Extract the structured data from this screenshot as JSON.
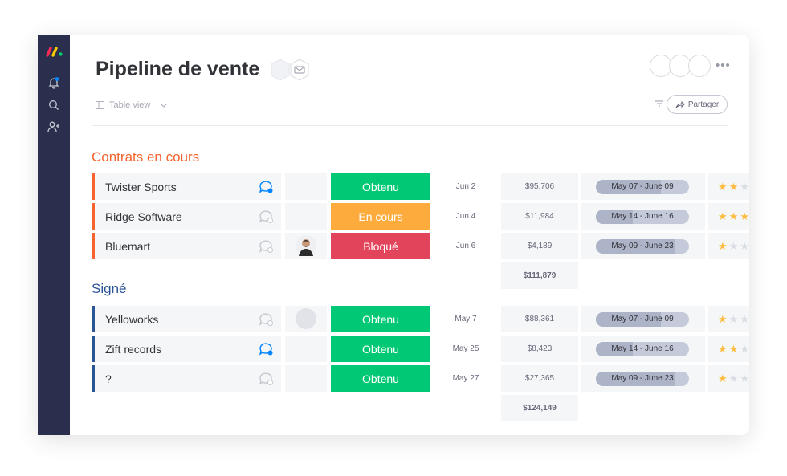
{
  "app": {
    "board_title": "Pipeline de vente",
    "view_label": "Table view",
    "share_label": "Partager",
    "more_label": "•••",
    "brand_colors": [
      "#f62b54",
      "#ffcb00",
      "#00ca72"
    ],
    "rail_icons": [
      "bell-icon",
      "search-icon",
      "add-user-icon"
    ]
  },
  "colors": {
    "group_orange": "#f5642d",
    "group_blue": "#2a5495",
    "status_done": "#00c875",
    "status_working": "#fdab3d",
    "status_stuck": "#e2445c",
    "star": "#fdbc40"
  },
  "groups": [
    {
      "title": "Contrats en cours",
      "color": "#f5642d",
      "rows": [
        {
          "name": "Twister Sports",
          "bubble_active": true,
          "owner": "",
          "status": "Obtenu",
          "status_color": "#00c875",
          "date": "Jun 2",
          "amount": "$95,706",
          "timeline": "May 07 - June 09",
          "timeline_progress": 0.7,
          "stars": 2
        },
        {
          "name": "Ridge Software",
          "bubble_active": false,
          "owner": "",
          "status": "En cours",
          "status_color": "#fdab3d",
          "date": "Jun 4",
          "amount": "$11,984",
          "timeline": "May 14 - June 16",
          "timeline_progress": 0.4,
          "stars": 3
        },
        {
          "name": "Bluemart",
          "bubble_active": false,
          "owner": "photo",
          "status": "Bloqué",
          "status_color": "#e2445c",
          "date": "Jun 6",
          "amount": "$4,189",
          "timeline": "May 09 - June 23",
          "timeline_progress": 0.85,
          "stars": 1
        }
      ],
      "total": "$111,879"
    },
    {
      "title": "Signé",
      "color": "#2a5495",
      "rows": [
        {
          "name": "Yelloworks",
          "bubble_active": false,
          "owner": "empty",
          "status": "Obtenu",
          "status_color": "#00c875",
          "date": "May 7",
          "amount": "$88,361",
          "timeline": "May 07 - June 09",
          "timeline_progress": 0.7,
          "stars": 1
        },
        {
          "name": "Zift records",
          "bubble_active": true,
          "owner": "",
          "status": "Obtenu",
          "status_color": "#00c875",
          "date": "May 25",
          "amount": "$8,423",
          "timeline": "May 14 - June 16",
          "timeline_progress": 0.4,
          "stars": 2
        },
        {
          "name": "?",
          "bubble_active": false,
          "owner": "",
          "status": "Obtenu",
          "status_color": "#00c875",
          "date": "May 27",
          "amount": "$27,365",
          "timeline": "May 09 - June 23",
          "timeline_progress": 0.85,
          "stars": 1
        }
      ],
      "total": "$124,149"
    }
  ]
}
